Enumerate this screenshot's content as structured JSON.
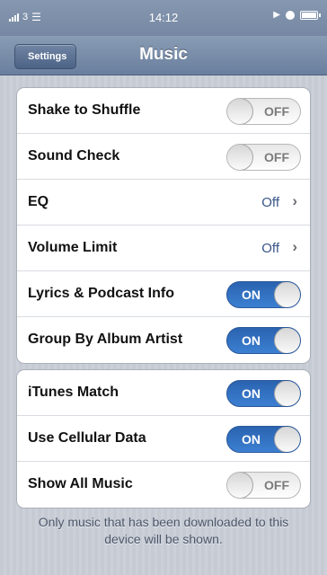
{
  "status_bar": {
    "carrier": "3",
    "time": "14:12",
    "icons": [
      "signal-icon",
      "wifi-icon",
      "play-icon",
      "alarm-icon",
      "battery-icon"
    ]
  },
  "nav": {
    "back_label": "Settings",
    "title": "Music"
  },
  "group1": {
    "shake_to_shuffle": {
      "label": "Shake to Shuffle",
      "state": "OFF"
    },
    "sound_check": {
      "label": "Sound Check",
      "state": "OFF"
    },
    "eq": {
      "label": "EQ",
      "value": "Off"
    },
    "volume_limit": {
      "label": "Volume Limit",
      "value": "Off"
    },
    "lyrics_podcast": {
      "label": "Lyrics & Podcast Info",
      "state": "ON"
    },
    "group_by_album_artist": {
      "label": "Group By Album Artist",
      "state": "ON"
    }
  },
  "group2": {
    "itunes_match": {
      "label": "iTunes Match",
      "state": "ON"
    },
    "use_cellular": {
      "label": "Use Cellular Data",
      "state": "ON"
    },
    "show_all_music": {
      "label": "Show All Music",
      "state": "OFF"
    }
  },
  "footer_note": "Only music that has been downloaded to this device will be shown.",
  "colors": {
    "toggle_on": "#3c7fd2",
    "nav_bar": "#6a7f9e",
    "detail_value": "#385487"
  }
}
